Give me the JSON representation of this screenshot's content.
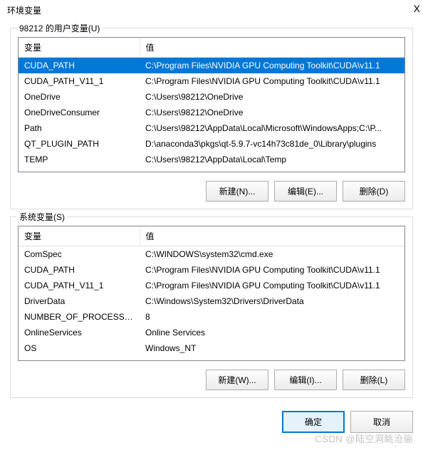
{
  "window": {
    "title": "环境变量",
    "close_glyph": "X"
  },
  "user_vars": {
    "label": "98212 的用户变量(U)",
    "col_name": "变量",
    "col_value": "值",
    "rows": [
      {
        "name": "CUDA_PATH",
        "value": "C:\\Program Files\\NVIDIA GPU Computing Toolkit\\CUDA\\v11.1",
        "selected": true
      },
      {
        "name": "CUDA_PATH_V11_1",
        "value": "C:\\Program Files\\NVIDIA GPU Computing Toolkit\\CUDA\\v11.1",
        "selected": false
      },
      {
        "name": "OneDrive",
        "value": "C:\\Users\\98212\\OneDrive",
        "selected": false
      },
      {
        "name": "OneDriveConsumer",
        "value": "C:\\Users\\98212\\OneDrive",
        "selected": false
      },
      {
        "name": "Path",
        "value": "C:\\Users\\98212\\AppData\\Local\\Microsoft\\WindowsApps;C:\\P...",
        "selected": false
      },
      {
        "name": "QT_PLUGIN_PATH",
        "value": "D:\\anaconda3\\pkgs\\qt-5.9.7-vc14h73c81de_0\\Library\\plugins",
        "selected": false
      },
      {
        "name": "TEMP",
        "value": "C:\\Users\\98212\\AppData\\Local\\Temp",
        "selected": false
      }
    ],
    "buttons": {
      "new": "新建(N)...",
      "edit": "编辑(E)...",
      "delete": "删除(D)"
    }
  },
  "system_vars": {
    "label": "系统变量(S)",
    "col_name": "变量",
    "col_value": "值",
    "rows": [
      {
        "name": "ComSpec",
        "value": "C:\\WINDOWS\\system32\\cmd.exe"
      },
      {
        "name": "CUDA_PATH",
        "value": "C:\\Program Files\\NVIDIA GPU Computing Toolkit\\CUDA\\v11.1"
      },
      {
        "name": "CUDA_PATH_V11_1",
        "value": "C:\\Program Files\\NVIDIA GPU Computing Toolkit\\CUDA\\v11.1"
      },
      {
        "name": "DriverData",
        "value": "C:\\Windows\\System32\\Drivers\\DriverData"
      },
      {
        "name": "NUMBER_OF_PROCESSORS",
        "value": "8"
      },
      {
        "name": "OnlineServices",
        "value": "Online Services"
      },
      {
        "name": "OS",
        "value": "Windows_NT"
      }
    ],
    "buttons": {
      "new": "新建(W)...",
      "edit": "编辑(I)...",
      "delete": "删除(L)"
    }
  },
  "footer": {
    "ok": "确定",
    "cancel": "取消"
  },
  "watermark": "CSDN @陆空洞眺沧骊"
}
